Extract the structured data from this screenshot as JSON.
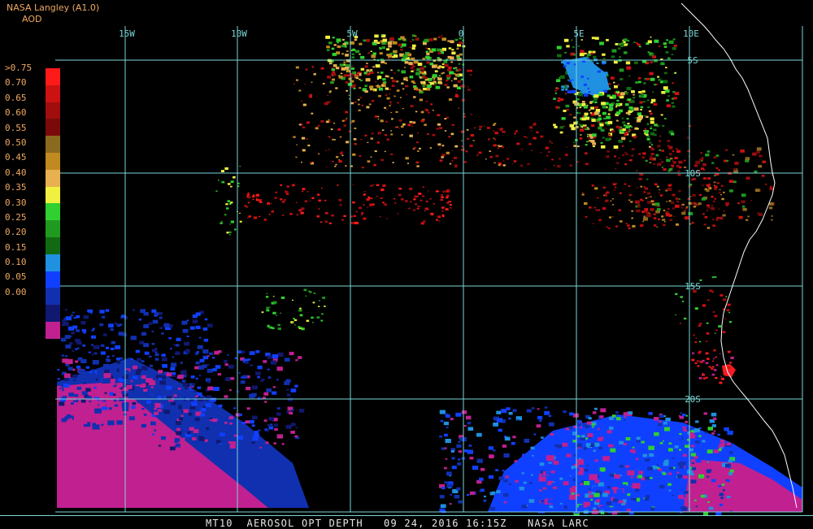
{
  "header": {
    "title": "NASA Langley (A1.0)",
    "variable": "AOD"
  },
  "footer": {
    "text": "MT10  AEROSOL OPT DEPTH   09 24, 2016 16:15Z   NASA LARC"
  },
  "colorbar": {
    "labels": [
      ">0.75",
      "0.70",
      "0.65",
      "0.60",
      "0.55",
      "0.50",
      "0.45",
      "0.40",
      "0.35",
      "0.30",
      "0.25",
      "0.20",
      "0.15",
      "0.10",
      "0.05",
      "0.00"
    ],
    "colors": [
      "#ff1a1a",
      "#cc1111",
      "#a00d0d",
      "#7a0a0a",
      "#8a6a1e",
      "#c08a20",
      "#e8b050",
      "#f0f040",
      "#30d030",
      "#1f9a1f",
      "#116a11",
      "#2090e0",
      "#1040ff",
      "#1030b0",
      "#101870",
      "#c02090"
    ]
  },
  "map": {
    "lon_labels": [
      "15W",
      "10W",
      "5W",
      "0",
      "5E",
      "10E"
    ],
    "lat_labels": [
      "5S",
      "10S",
      "15S",
      "20S"
    ],
    "grid_color": "#7ad6d6",
    "coast_color": "#ffffff"
  }
}
